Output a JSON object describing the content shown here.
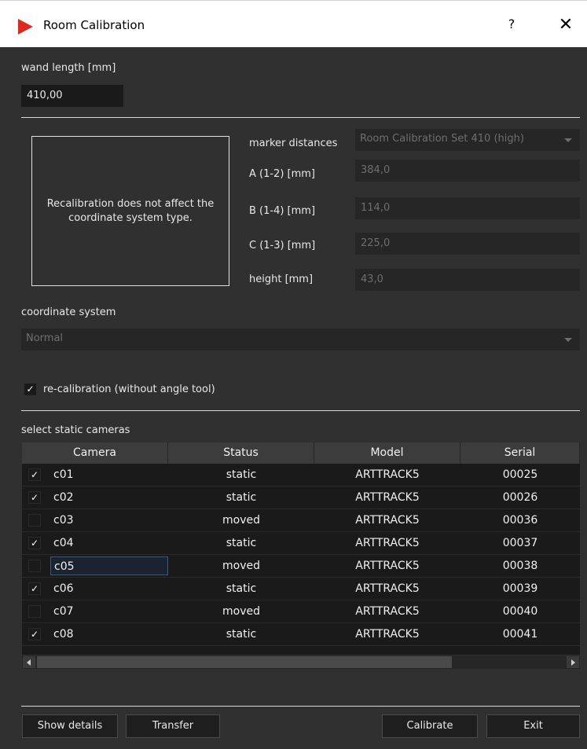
{
  "window": {
    "title": "Room Calibration",
    "help_label": "?",
    "close_label": "✕",
    "icon_color": "#e0281e"
  },
  "wand": {
    "label": "wand length [mm]",
    "value": "410,00"
  },
  "info_text": "Recalibration does not affect the coordinate system type.",
  "markers": {
    "distances_label": "marker distances",
    "distances_value": "Room Calibration Set 410 (high)",
    "a_label": "A (1-2) [mm]",
    "a_value": "384,0",
    "b_label": "B (1-4) [mm]",
    "b_value": "114,0",
    "c_label": "C (1-3) [mm]",
    "c_value": "225,0",
    "height_label": "height [mm]",
    "height_value": "43,0"
  },
  "coord": {
    "label": "coordinate system",
    "value": "Normal"
  },
  "recalibration": {
    "label": "re-calibration (without angle tool)",
    "checked": true
  },
  "cameras": {
    "section_label": "select static cameras",
    "columns": [
      "Camera",
      "Status",
      "Model",
      "Serial"
    ],
    "rows": [
      {
        "checked": true,
        "name": "c01",
        "status": "static",
        "model": "ARTTRACK5",
        "serial": "00025"
      },
      {
        "checked": true,
        "name": "c02",
        "status": "static",
        "model": "ARTTRACK5",
        "serial": "00026"
      },
      {
        "checked": false,
        "name": "c03",
        "status": "moved",
        "model": "ARTTRACK5",
        "serial": "00036"
      },
      {
        "checked": true,
        "name": "c04",
        "status": "static",
        "model": "ARTTRACK5",
        "serial": "00037"
      },
      {
        "checked": false,
        "name": "c05",
        "status": "moved",
        "model": "ARTTRACK5",
        "serial": "00038"
      },
      {
        "checked": true,
        "name": "c06",
        "status": "static",
        "model": "ARTTRACK5",
        "serial": "00039"
      },
      {
        "checked": false,
        "name": "c07",
        "status": "moved",
        "model": "ARTTRACK5",
        "serial": "00040"
      },
      {
        "checked": true,
        "name": "c08",
        "status": "static",
        "model": "ARTTRACK5",
        "serial": "00041"
      }
    ]
  },
  "buttons": {
    "show_details": "Show details",
    "transfer": "Transfer",
    "calibrate": "Calibrate",
    "exit": "Exit"
  }
}
